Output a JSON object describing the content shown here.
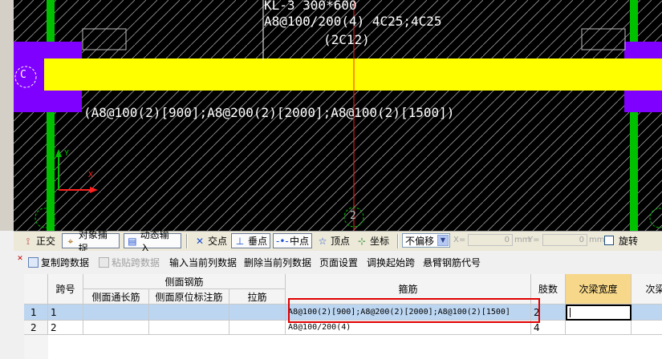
{
  "cad": {
    "beam_name": "KL-3 300*600",
    "beam_stirrup": "A8@100/200(4) 4C25;4C25",
    "beam_side": "(2C12)",
    "span_stirrup": "(A8@100(2)[900];A8@200(2)[2000];A8@100(2)[1500])",
    "axis_left": "C",
    "axis_bottom": "2",
    "ucs_y": "Y",
    "ucs_x": "X",
    "colors": {
      "beam": "#ffff00",
      "column": "#8000ff",
      "border": "#00c000",
      "axis_line": "#ff2020"
    }
  },
  "snap_toolbar": {
    "orthogonal": "正交",
    "object_snap": "对象捕捉",
    "dynamic_input": "动态输入",
    "intersection": "交点",
    "perpendicular": "垂点",
    "midpoint": "中点",
    "vertex": "顶点",
    "coordinate": "坐标",
    "offset_select": "不偏移",
    "x_label": "X=",
    "x_value": "0",
    "y_label": "Y=",
    "y_value": "0",
    "unit": "mm",
    "rotate": "旋转"
  },
  "grid_toolbar": {
    "copy_span": "复制跨数据",
    "paste_span": "粘贴跨数据",
    "input_column": "输入当前列数据",
    "delete_column": "删除当前列数据",
    "page_setup": "页面设置",
    "adjust_start": "调换起始跨",
    "cantilever_code": "悬臂钢筋代号"
  },
  "table": {
    "headers": {
      "span_no": "跨号",
      "side_rebar": "侧面钢筋",
      "side_through": "侧面通长筋",
      "side_origin": "侧面原位标注筋",
      "tie": "拉筋",
      "stirrup": "箍筋",
      "legs": "肢数",
      "sec_beam_width": "次梁宽度",
      "sec_beam": "次梁"
    },
    "rows": [
      {
        "row": "1",
        "span": "1",
        "stirrup": "A8@100(2)[900];A8@200(2)[2000];A8@100(2)[1500]",
        "legs": "2"
      },
      {
        "row": "2",
        "span": "2",
        "stirrup": "A8@100/200(4)",
        "legs": "4"
      }
    ]
  }
}
